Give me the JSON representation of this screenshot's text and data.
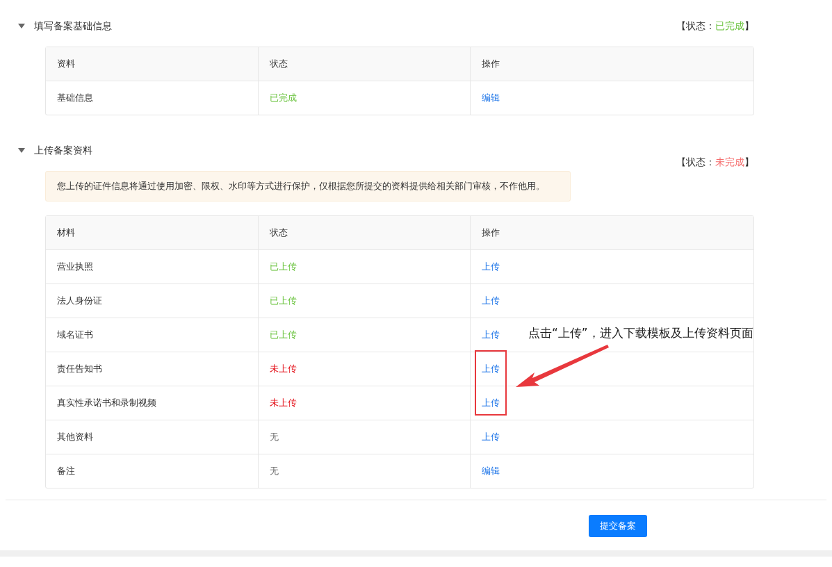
{
  "sections": [
    {
      "title": "填写备案基础信息",
      "expanded": true,
      "status": {
        "prefix": "【状态：",
        "value": "已完成",
        "kind": "done",
        "suffix": "】"
      },
      "table": {
        "columns": [
          "资料",
          "状态",
          "操作"
        ],
        "rows": [
          {
            "name": "基础信息",
            "status": {
              "text": "已完成",
              "kind": "done"
            },
            "action": "编辑",
            "annotated": false
          }
        ]
      }
    },
    {
      "title": "上传备案资料",
      "expanded": true,
      "status": {
        "prefix": "【状态：",
        "value": "未完成",
        "kind": "pending",
        "suffix": "】"
      },
      "notice": "您上传的证件信息将通过使用加密、限权、水印等方式进行保护，仅根据您所提交的资料提供给相关部门审核，不作他用。",
      "table": {
        "columns": [
          "材料",
          "状态",
          "操作"
        ],
        "rows": [
          {
            "name": "营业执照",
            "status": {
              "text": "已上传",
              "kind": "done"
            },
            "action": "上传",
            "annotated": false
          },
          {
            "name": "法人身份证",
            "status": {
              "text": "已上传",
              "kind": "done"
            },
            "action": "上传",
            "annotated": false
          },
          {
            "name": "域名证书",
            "status": {
              "text": "已上传",
              "kind": "done"
            },
            "action": "上传",
            "annotated": false
          },
          {
            "name": "责任告知书",
            "status": {
              "text": "未上传",
              "kind": "missing"
            },
            "action": "上传",
            "annotated": true
          },
          {
            "name": "真实性承诺书和录制视频",
            "status": {
              "text": "未上传",
              "kind": "missing"
            },
            "action": "上传",
            "annotated": true
          },
          {
            "name": "其他资料",
            "status": {
              "text": "无",
              "kind": "none"
            },
            "action": "上传",
            "annotated": false
          },
          {
            "name": "备注",
            "status": {
              "text": "无",
              "kind": "none"
            },
            "action": "编辑",
            "annotated": false
          }
        ]
      }
    }
  ],
  "annotation": {
    "text": "点击“上传”，进入下载模板及上传资料页面"
  },
  "submit_button": "提交备案"
}
